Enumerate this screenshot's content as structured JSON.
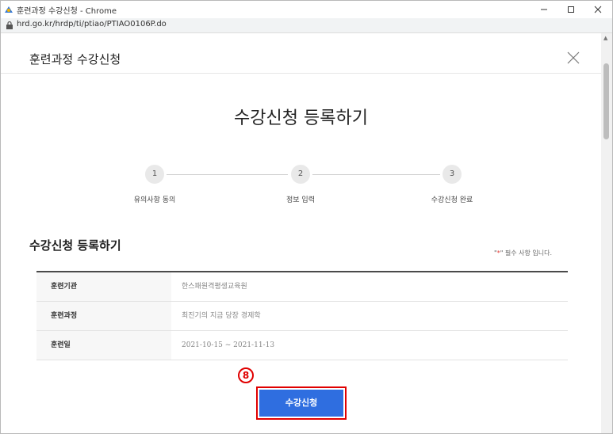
{
  "window": {
    "title": "훈련과정 수강신청 - Chrome"
  },
  "address_bar": {
    "url": "hrd.go.kr/hrdp/ti/ptiao/PTIAO0106P.do"
  },
  "modal": {
    "title": "훈련과정 수강신청"
  },
  "page": {
    "heading": "수강신청 등록하기"
  },
  "steps": [
    {
      "number": "1",
      "label": "유의사항 동의"
    },
    {
      "number": "2",
      "label": "정보 입력"
    },
    {
      "number": "3",
      "label": "수강신청 완료"
    }
  ],
  "section": {
    "title": "수강신청 등록하기",
    "required_note": {
      "open": "\"",
      "star": "*",
      "text": "\" 필수 사항 입니다."
    }
  },
  "info_table": [
    {
      "label": "훈련기관",
      "value": "한스패원격평생교육원"
    },
    {
      "label": "훈련과정",
      "value": "최진기의 지금 당장 경제학"
    },
    {
      "label": "훈련일",
      "value": "2021-10-15 ~ 2021-11-13"
    }
  ],
  "annotation": {
    "marker": "8"
  },
  "submit": {
    "label": "수강신청"
  },
  "colors": {
    "accent": "#2f6ee0",
    "highlight": "#e00000",
    "required": "#e53935"
  },
  "icons": [
    "chrome-app-icon",
    "lock-icon",
    "minimize-icon",
    "maximize-icon",
    "close-icon",
    "modal-close-icon"
  ]
}
